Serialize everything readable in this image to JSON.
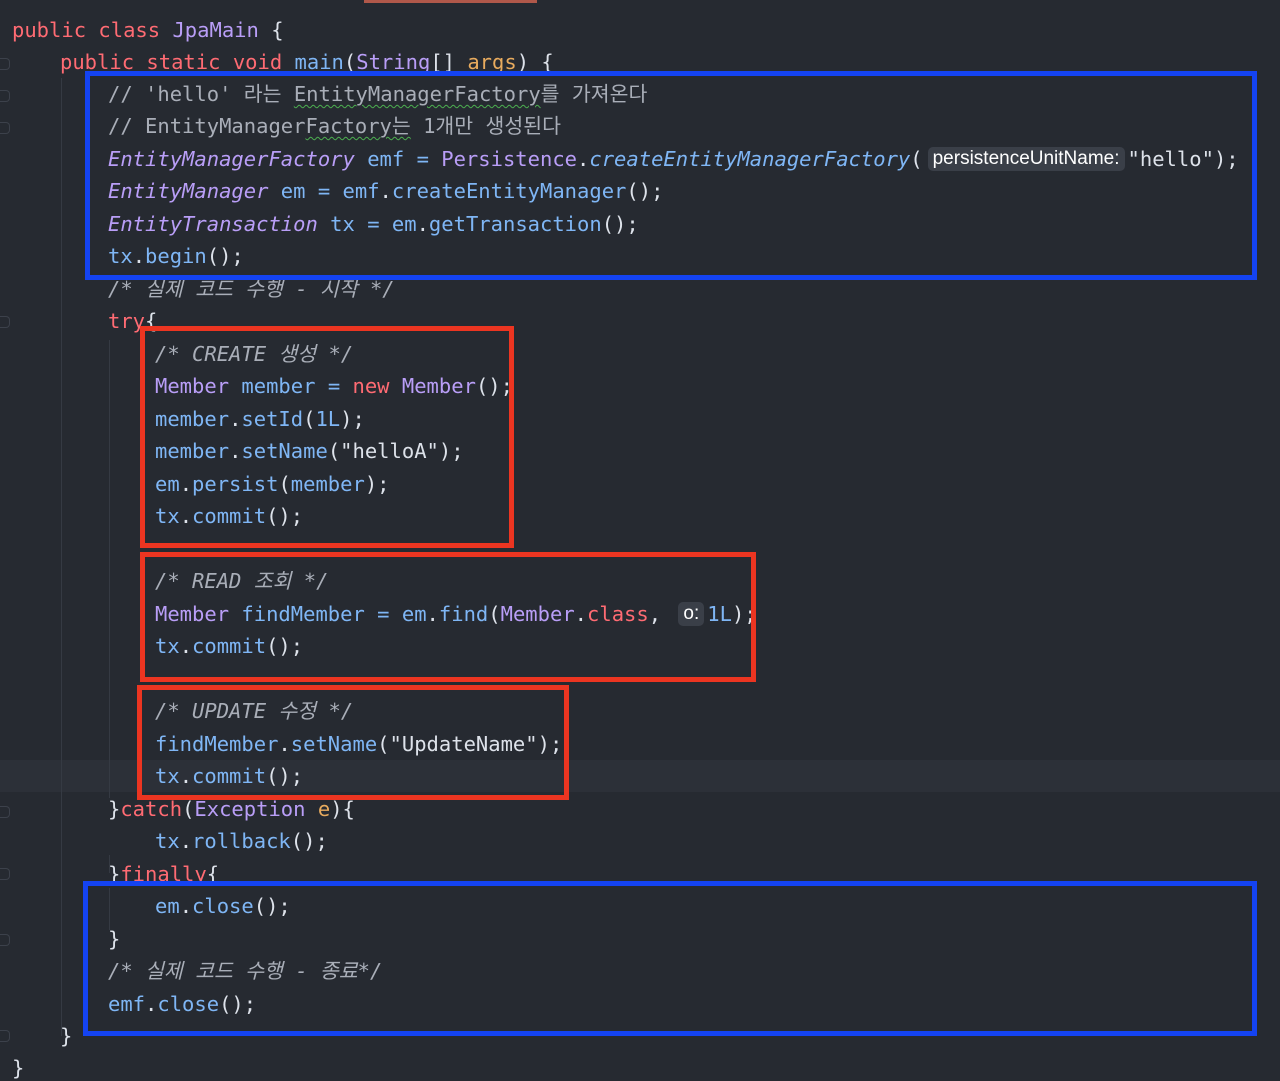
{
  "code": {
    "class_decl": {
      "kw_public": "public",
      "kw_class": "class",
      "class_name": "JpaMain",
      "brace": "{"
    },
    "main_decl": {
      "kw_public": "public",
      "kw_static": "static",
      "kw_void": "void",
      "name": "main",
      "open": "(",
      "param_type": "String",
      "brackets": "[]",
      "param_name": "args",
      "close": ")",
      "brace": "{"
    },
    "comment1": {
      "prefix": "// 'hello' 라는 ",
      "squiggle": "EntityManagerFactory",
      "suffix": "를 가져온다"
    },
    "comment2": {
      "prefix": "// EntityManager",
      "squiggle": "Factory는",
      "suffix": " 1개만 생성된다"
    },
    "emf_line": {
      "type": "EntityManagerFactory",
      "var": "emf",
      "eq": "=",
      "cls": "Persistence",
      "dot": ".",
      "method": "createEntityManagerFactory",
      "open": "(",
      "hint": "persistenceUnitName:",
      "arg": "\"hello\"",
      "end": ");"
    },
    "em_line": {
      "type": "EntityManager",
      "var": "em",
      "eq": "=",
      "obj": "emf",
      "dot": ".",
      "method": "createEntityManager",
      "end": "();"
    },
    "tx_line": {
      "type": "EntityTransaction",
      "var": "tx",
      "eq": "=",
      "obj": "em",
      "dot": ".",
      "method": "getTransaction",
      "end": "();"
    },
    "begin_line": {
      "obj": "tx",
      "dot": ".",
      "method": "begin",
      "end": "();"
    },
    "start_comment": "/* 실제 코드 수행 - 시작 */",
    "try_line": {
      "kw": "try",
      "brace": "{"
    },
    "create_comment": "/* CREATE 생성 */",
    "member_new": {
      "type": "Member",
      "var": "member",
      "eq": "=",
      "kw_new": "new",
      "cls": "Member",
      "end": "();"
    },
    "set_id": {
      "obj": "member",
      "dot": ".",
      "method": "setId",
      "open": "(",
      "arg": "1L",
      "end": ");"
    },
    "set_name": {
      "obj": "member",
      "dot": ".",
      "method": "setName",
      "open": "(",
      "arg": "\"helloA\"",
      "end": ");"
    },
    "persist": {
      "obj": "em",
      "dot": ".",
      "method": "persist",
      "open": "(",
      "arg": "member",
      "end": ");"
    },
    "commit": {
      "obj": "tx",
      "dot": ".",
      "method": "commit",
      "end": "();"
    },
    "read_comment": "/* READ 조회 */",
    "find_line": {
      "type": "Member",
      "var": "findMember",
      "eq": "=",
      "obj": "em",
      "dot": ".",
      "method": "find",
      "open": "(",
      "cls": "Member",
      "dot2": ".",
      "kw_class": "class",
      "comma": ",",
      "hint": "o:",
      "arg": "1L",
      "end": ");"
    },
    "update_comment": "/* UPDATE 수정 */",
    "update_line": {
      "obj": "findMember",
      "dot": ".",
      "method": "setName",
      "open": "(",
      "arg": "\"UpdateName\"",
      "end": ");"
    },
    "catch_line": {
      "close": "}",
      "kw": "catch",
      "open": "(",
      "type": "Exception",
      "var": "e",
      "end": "){"
    },
    "rollback": {
      "obj": "tx",
      "dot": ".",
      "method": "rollback",
      "end": "();"
    },
    "finally_line": {
      "close": "}",
      "kw": "finally",
      "brace": "{"
    },
    "em_close": {
      "obj": "em",
      "dot": ".",
      "method": "close",
      "end": "();"
    },
    "close_brace": "}",
    "end_comment": "/* 실제 코드 수행 - 종료*/",
    "emf_close": {
      "obj": "emf",
      "dot": ".",
      "method": "close",
      "end": "();"
    }
  },
  "colors": {
    "background": "#262a31",
    "keyword": "#ff6b73",
    "class_name": "#b99ef7",
    "identifier": "#7fb6f5",
    "parameter": "#e8ab5e",
    "comment": "#a9aeb8",
    "highlight_blue": "#1443f2",
    "highlight_red": "#ec3521"
  }
}
